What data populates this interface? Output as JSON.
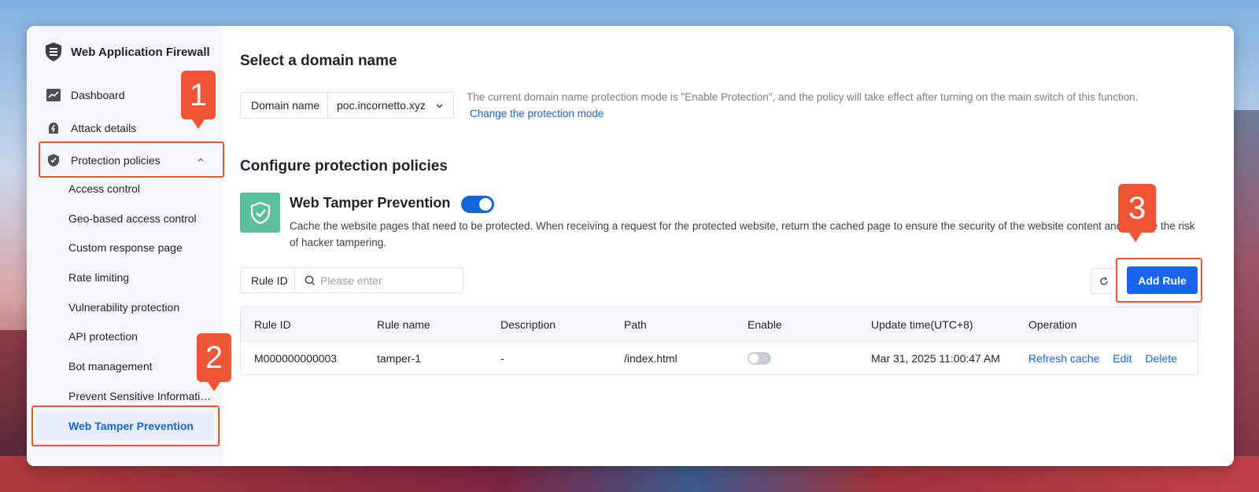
{
  "app": {
    "title": "Web Application Firewall"
  },
  "sidebar": {
    "items": [
      {
        "label": "Dashboard",
        "icon": "chart-icon"
      },
      {
        "label": "Attack details",
        "icon": "alert-icon"
      },
      {
        "label": "Protection policies",
        "icon": "shield-icon",
        "expanded": true
      }
    ],
    "subitems": [
      "Access control",
      "Geo-based access control",
      "Custom response page",
      "Rate limiting",
      "Vulnerability protection",
      "API protection",
      "Bot management",
      "Prevent Sensitive Informati…",
      "Web Tamper Prevention"
    ],
    "active_subitem": "Web Tamper Prevention"
  },
  "domain_section": {
    "title": "Select a domain name",
    "label": "Domain name",
    "value": "poc.incornetto.xyz",
    "notice": "The current domain name protection mode is \"Enable Protection\", and the policy will take effect after turning on the main switch of this function.",
    "link": "Change the protection mode"
  },
  "policy_section": {
    "title": "Configure protection policies",
    "feature_title": "Web Tamper Prevention",
    "feature_enabled": true,
    "feature_desc": "Cache the website pages that need to be protected. When receiving a request for the protected website, return the cached page to ensure the security of the website content and reduce the risk of hacker tampering."
  },
  "filter": {
    "label": "Rule ID",
    "placeholder": "Please enter"
  },
  "add_rule_label": "Add Rule",
  "table": {
    "columns": [
      "Rule ID",
      "Rule name",
      "Description",
      "Path",
      "Enable",
      "Update time(UTC+8)",
      "Operation"
    ],
    "rows": [
      {
        "rule_id": "M000000000003",
        "rule_name": "tamper-1",
        "description": "-",
        "path": "/index.html",
        "enabled": false,
        "update_time": "Mar 31, 2025 11:00:47 AM",
        "ops": [
          "Refresh cache",
          "Edit",
          "Delete"
        ]
      }
    ]
  },
  "callouts": [
    "1",
    "2",
    "3"
  ],
  "colors": {
    "accent": "#1664d9",
    "callout": "#ef5534",
    "feature_icon": "#5bbf9a"
  }
}
